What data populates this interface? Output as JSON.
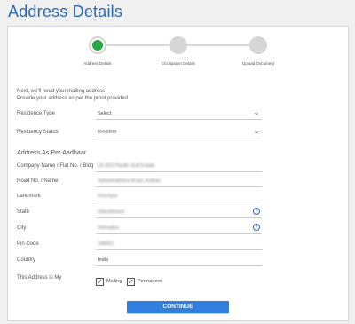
{
  "page": {
    "title": "Address Details"
  },
  "stepper": {
    "steps": [
      {
        "label": "Address Details",
        "state": "active"
      },
      {
        "label": "Occupation Details",
        "state": "pending"
      },
      {
        "label": "Upload Document",
        "state": "pending"
      }
    ]
  },
  "intro": {
    "line1": "Next, we'll need your mailing address",
    "line2": "Provide your address as per the proof provided"
  },
  "form": {
    "residence_type": {
      "label": "Residence Type",
      "value": "Select"
    },
    "residency_status": {
      "label": "Residency Status",
      "value": "Resident"
    },
    "section_heading": "Address As Per Aadhaar",
    "company_name": {
      "label": "Company Name / Flat No. / Bldg",
      "value": "D2-603 Pacific Golf Estate"
    },
    "road_no": {
      "label": "Road No. / Name",
      "value": "Sahastradhara Road, Kulhan"
    },
    "landmark": {
      "label": "Landmark",
      "value": "Kerenpur"
    },
    "state": {
      "label": "State",
      "value": "Uttarakhand"
    },
    "city": {
      "label": "City",
      "value": "Dehradun"
    },
    "pin_code": {
      "label": "Pin Code",
      "value": "248001"
    },
    "country": {
      "label": "Country",
      "value": "India"
    },
    "address_is": {
      "label": "This Address is My",
      "options": [
        {
          "label": "Mailing",
          "checked": true
        },
        {
          "label": "Permanent",
          "checked": true
        }
      ]
    }
  },
  "actions": {
    "continue_label": "CONTINUE"
  },
  "colors": {
    "brand": "#2b68b3",
    "button": "#2f7ee0",
    "active_step": "#28a745"
  }
}
